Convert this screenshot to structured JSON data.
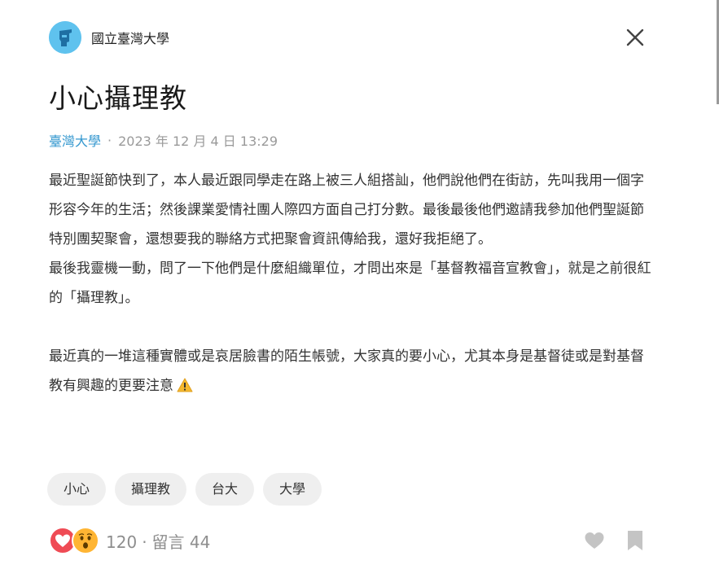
{
  "header": {
    "board_name": "國立臺灣大學",
    "avatar_icon": "school-mascot-avatar",
    "close_icon": "close-icon"
  },
  "post": {
    "title": "小心攝理教",
    "school": "臺灣大學",
    "separator": "·",
    "date": "2023 年 12 月 4 日 13:29",
    "paragraphs": [
      "最近聖誕節快到了，本人最近跟同學走在路上被三人組搭訕，他們說他們在街訪，先叫我用一個字形容今年的生活；然後課業愛情社團人際四方面自己打分數。最後最後他們邀請我參加他們聖誕節特別團契聚會，還想要我的聯絡方式把聚會資訊傳給我，還好我拒絕了。",
      "最後我靈機一動，問了一下他們是什麼組織單位，才問出來是「基督教福音宣教會」，就是之前很紅的「攝理教」。",
      "",
      "最近真的一堆這種實體或是哀居臉書的陌生帳號，大家真的要小心，尤其本身是基督徒或是對基督教有興趣的更要注意"
    ],
    "warning_icon": "warning-icon"
  },
  "tags": [
    "小心",
    "攝理教",
    "台大",
    "大學"
  ],
  "footer": {
    "reaction_icons": [
      "heart-reaction-icon",
      "surprised-reaction-icon"
    ],
    "like_count": "120",
    "separator": "·",
    "comment_label": "留言 44",
    "like_button_icon": "heart-icon",
    "bookmark_button_icon": "bookmark-icon"
  },
  "colors": {
    "accent": "#3397cf",
    "meta_gray": "#9a9a9a",
    "tag_bg": "#efefef",
    "heart_red": "#ef4b55",
    "surprised_orange": "#ffb533",
    "action_gray": "#c4c4c4"
  }
}
